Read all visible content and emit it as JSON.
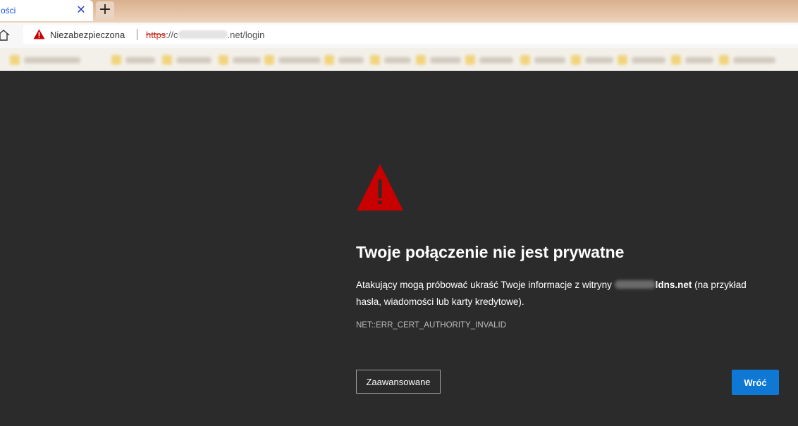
{
  "tab": {
    "title": "ości",
    "close_glyph": "✕",
    "new_tab_glyph": "+"
  },
  "address_bar": {
    "security_label": "Niezabezpieczona",
    "url_scheme": "https",
    "url_after_scheme": "://c",
    "url_tail": ".net/login"
  },
  "error_page": {
    "title": "Twoje połączenie nie jest prywatne",
    "description_part1": "Atakujący mogą próbować ukraść Twoje informacje z witryny ",
    "host_suffix": "ldns.net",
    "description_part2": " (na przykład hasła, wiadomości lub karty kredytowe).",
    "error_code": "NET::ERR_CERT_AUTHORITY_INVALID",
    "advanced_button": "Zaawansowane",
    "back_button": "Wróć"
  },
  "colors": {
    "warning_red": "#c80000",
    "background": "#2b2b2b",
    "primary_button": "#0f78d4"
  },
  "icons": [
    "close-icon",
    "plus-icon",
    "home-icon",
    "warning-icon"
  ]
}
